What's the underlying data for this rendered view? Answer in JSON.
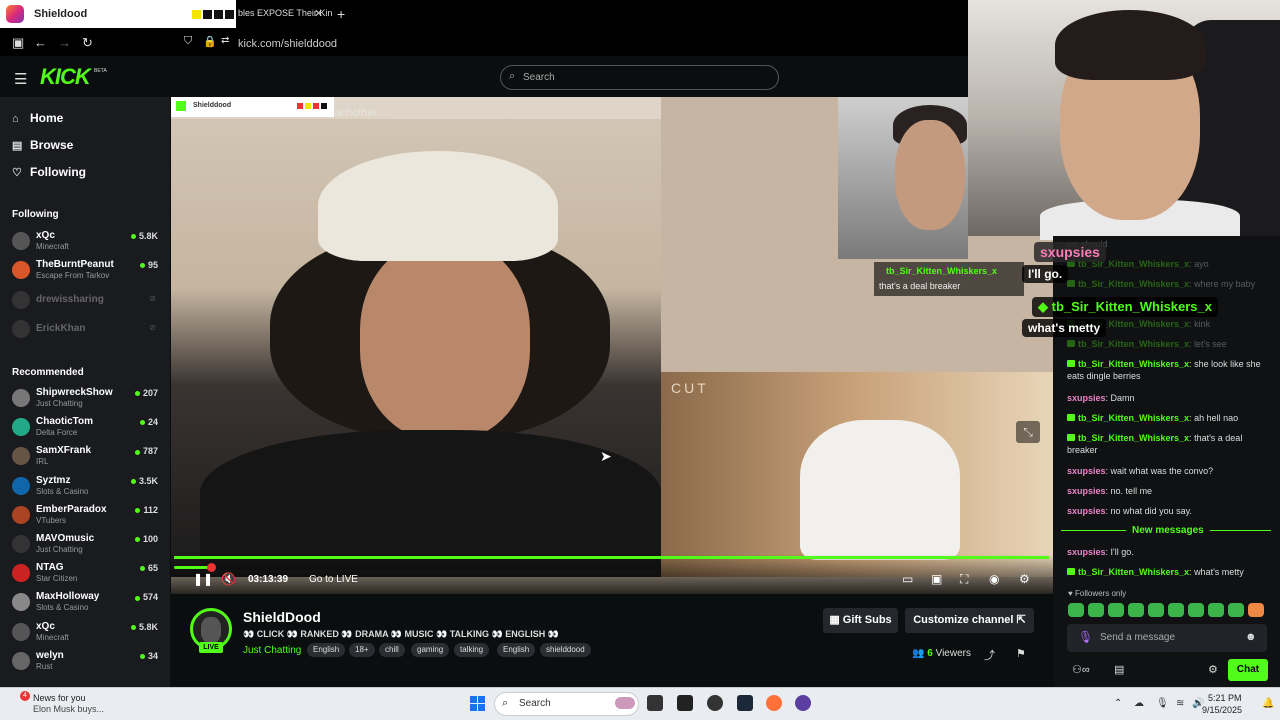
{
  "browser": {
    "active_tab_title": "Shieldood",
    "second_tab_title": "bles EXPOSE Their Kin",
    "url": "kick.com/shielddood"
  },
  "site": {
    "logo": "KICK",
    "logo_badge": "BETA",
    "search_placeholder": "Search"
  },
  "sidebar": {
    "nav": [
      {
        "label": "Home",
        "icon": "home-icon"
      },
      {
        "label": "Browse",
        "icon": "browse-icon"
      },
      {
        "label": "Following",
        "icon": "heart-icon"
      }
    ],
    "following_header": "Following",
    "following": [
      {
        "name": "xQc",
        "category": "Minecraft",
        "viewers": "5.8K",
        "live": true
      },
      {
        "name": "TheBurntPeanut",
        "category": "Escape From Tarkov",
        "viewers": "95",
        "live": true
      },
      {
        "name": "drewissharing",
        "category": "",
        "viewers": "",
        "live": false
      },
      {
        "name": "ErickKhan",
        "category": "",
        "viewers": "",
        "live": false
      }
    ],
    "recommended_header": "Recommended",
    "recommended": [
      {
        "name": "ShipwreckShow",
        "category": "Just Chatting",
        "viewers": "207"
      },
      {
        "name": "ChaoticTom",
        "category": "Delta Force",
        "viewers": "24"
      },
      {
        "name": "SamXFrank",
        "category": "IRL",
        "viewers": "787"
      },
      {
        "name": "Syztmz",
        "category": "Slots & Casino",
        "viewers": "3.5K"
      },
      {
        "name": "EmberParadox",
        "category": "VTubers",
        "viewers": "112"
      },
      {
        "name": "MAVOmusic",
        "category": "Just Chatting",
        "viewers": "100"
      },
      {
        "name": "NTAG",
        "category": "Star Citizen",
        "viewers": "65"
      },
      {
        "name": "MaxHolloway",
        "category": "Slots & Casino",
        "viewers": "574"
      },
      {
        "name": "xQc",
        "category": "Minecraft",
        "viewers": "5.8K"
      },
      {
        "name": "welyn",
        "category": "Rust",
        "viewers": "34"
      }
    ]
  },
  "video": {
    "overlay_caption": "...bles Their Kins to Eachother...",
    "mini_title": "Shielddood",
    "cut_label": "CUT",
    "cam_chat_user": "tb_Sir_Kitten_Whiskers_x",
    "cam_chat_msg": "that's a deal breaker",
    "time": "03:13:39",
    "go_live": "Go to LIVE",
    "progress": 0.04
  },
  "channel": {
    "name": "ShieldDood",
    "live_badge": "LIVE",
    "title": "👀 CLICK 👀 RANKED 👀 DRAMA 👀 MUSIC 👀 TALKING 👀 ENGLISH 👀",
    "category": "Just Chatting",
    "tags": [
      "English",
      "18+",
      "chill",
      "gaming",
      "talking",
      "English",
      "shielddood"
    ],
    "gift_subs": "Gift Subs",
    "customize": "Customize channel",
    "viewers_count": "6",
    "viewers_label": "Viewers"
  },
  "overlay_chat": {
    "user1": "sxupsies",
    "msg1": "I'll go.",
    "user2": "tb_Sir_Kitten_Whiskers_x",
    "msg2": "what's metty"
  },
  "chat": {
    "messages": [
      {
        "user": "",
        "text": "we should",
        "pink": false,
        "faded": true
      },
      {
        "user": "tb_Sir_Kitten_Whiskers_x",
        "text": "ayo",
        "pink": false,
        "faded": true
      },
      {
        "user": "tb_Sir_Kitten_Whiskers_x",
        "text": "where my baby",
        "pink": false,
        "faded": true
      },
      {
        "user": "tb_Sir_Kitten_Whiskers_x",
        "text": "kink",
        "pink": false,
        "faded": true
      },
      {
        "user": "tb_Sir_Kitten_Whiskers_x",
        "text": "let's see",
        "pink": false,
        "faded": true
      },
      {
        "user": "tb_Sir_Kitten_Whiskers_x",
        "text": "she look like she eats dingle berries",
        "pink": false,
        "faded": false
      },
      {
        "user": "sxupsies",
        "text": "Damn",
        "pink": true,
        "faded": false
      },
      {
        "user": "tb_Sir_Kitten_Whiskers_x",
        "text": "ah hell nao",
        "pink": false,
        "faded": false
      },
      {
        "user": "tb_Sir_Kitten_Whiskers_x",
        "text": "that's a deal breaker",
        "pink": false,
        "faded": false
      },
      {
        "user": "sxupsies",
        "text": "wait what was the convo?",
        "pink": true,
        "faded": false
      },
      {
        "user": "sxupsies",
        "text": "no. tell me",
        "pink": true,
        "faded": false
      },
      {
        "user": "sxupsies",
        "text": "no what did you say.",
        "pink": true,
        "faded": false
      }
    ],
    "new_messages": "New messages",
    "after": [
      {
        "user": "sxupsies",
        "text": "I'll go.",
        "pink": true
      },
      {
        "user": "tb_Sir_Kitten_Whiskers_x",
        "text": "what's metty",
        "pink": false
      }
    ],
    "followers_only": "Followers only",
    "input_placeholder": "Send a message",
    "send_label": "Chat"
  },
  "taskbar": {
    "news_count": "4",
    "news_title": "News for you",
    "news_sub": "Elon Musk buys...",
    "search_placeholder": "Search",
    "time": "5:21 PM",
    "date": "9/15/2025"
  },
  "colors": {
    "accent": "#53fc18",
    "chat_pink": "#e984c8"
  }
}
